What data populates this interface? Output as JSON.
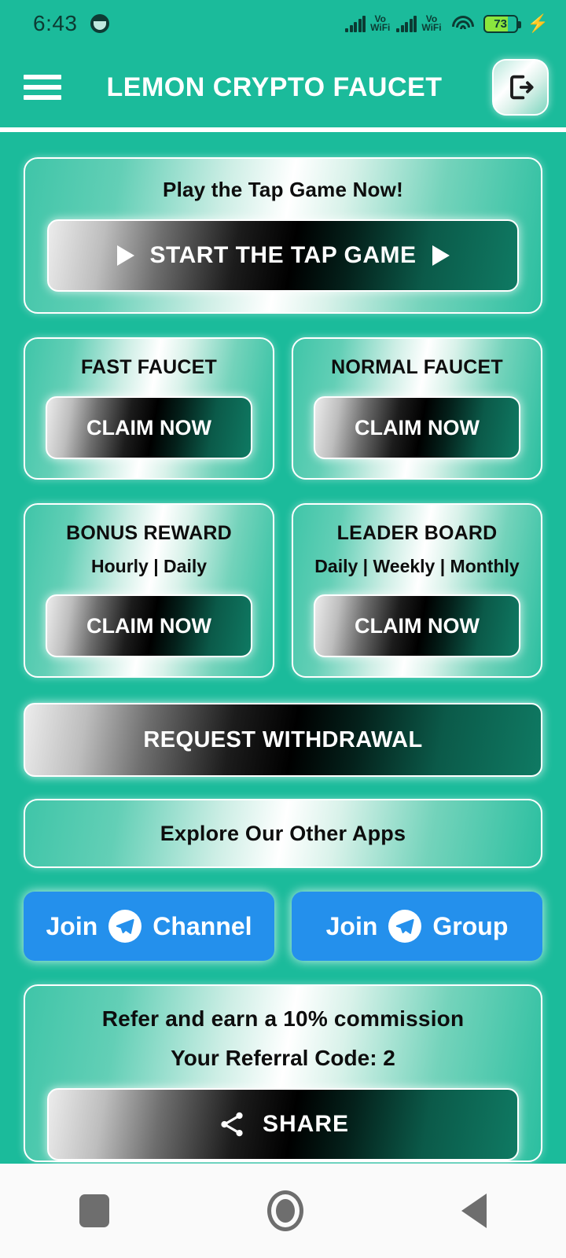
{
  "status_bar": {
    "time": "6:43",
    "app_icon": "notification-app-icon",
    "signal_1": {
      "icon": "cellular-signal-icon",
      "label_top": "Vo",
      "label_bottom": "WiFi"
    },
    "signal_2": {
      "icon": "cellular-signal-icon",
      "label_top": "Vo",
      "label_bottom": "WiFi"
    },
    "wifi_icon": "wifi-icon",
    "battery": {
      "percent": "73",
      "icon": "battery-icon"
    },
    "charging_icon": "⚡"
  },
  "app_bar": {
    "menu_icon": "hamburger-menu-icon",
    "title": "LEMON CRYPTO FAUCET",
    "logout_icon": "logout-icon"
  },
  "hero": {
    "title": "Play the Tap Game Now!",
    "button_label": "START THE TAP GAME",
    "left_icon": "play-triangle-icon",
    "right_icon": "play-triangle-icon"
  },
  "faucets": [
    {
      "title": "FAST FAUCET",
      "button_label": "CLAIM NOW"
    },
    {
      "title": "NORMAL FAUCET",
      "button_label": "CLAIM NOW"
    }
  ],
  "rewards": [
    {
      "title": "BONUS REWARD",
      "subtitle": "Hourly | Daily",
      "button_label": "CLAIM NOW"
    },
    {
      "title": "LEADER BOARD",
      "subtitle": "Daily | Weekly | Monthly",
      "button_label": "CLAIM NOW"
    }
  ],
  "withdrawal": {
    "button_label": "REQUEST WITHDRAWAL"
  },
  "explore": {
    "title": "Explore Our Other Apps"
  },
  "telegram": [
    {
      "prefix": "Join",
      "suffix": "Channel",
      "icon": "telegram-icon"
    },
    {
      "prefix": "Join",
      "suffix": "Group",
      "icon": "telegram-icon"
    }
  ],
  "referral": {
    "title": "Refer and earn a 10% commission",
    "code_label": "Your Referral Code: 2",
    "share_label": "SHARE",
    "share_icon": "share-icon"
  },
  "nav_bar": {
    "recents": "recents-square-icon",
    "home": "home-circle-icon",
    "back": "back-triangle-icon"
  },
  "colors": {
    "brand_teal": "#1BBB9B",
    "telegram_blue": "#2490EC",
    "battery_green": "#8BE63D",
    "text_dark": "#0D0D0D",
    "white": "#FFFFFF"
  }
}
